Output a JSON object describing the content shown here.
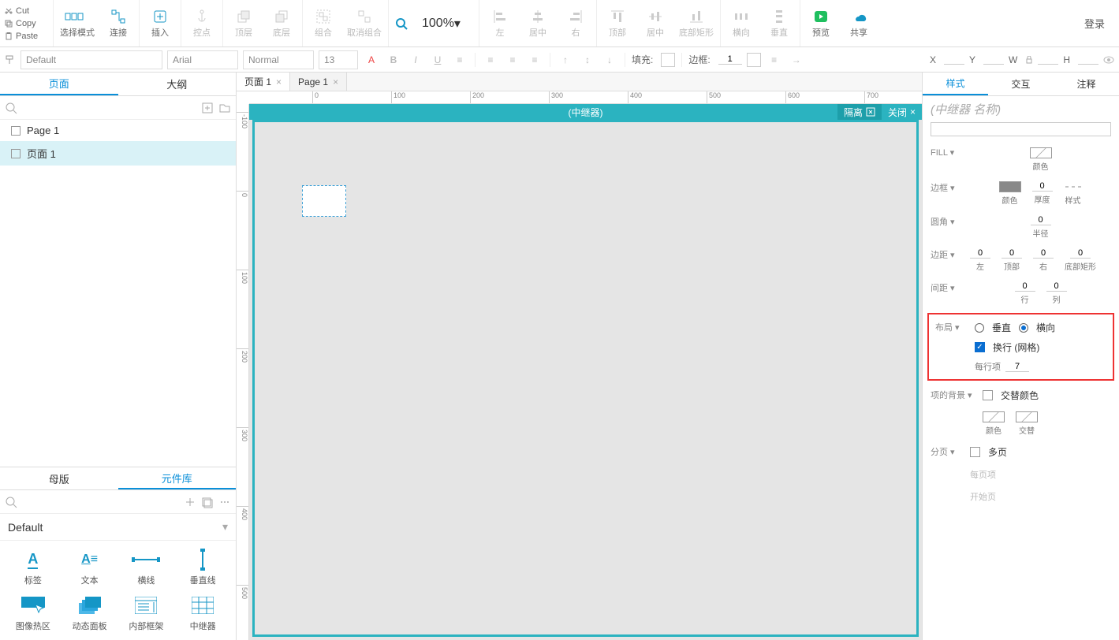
{
  "clipboard": {
    "cut": "Cut",
    "copy": "Copy",
    "paste": "Paste"
  },
  "toolbar": {
    "select_mode": "选择模式",
    "connect": "连接",
    "insert": "插入",
    "anchor": "控点",
    "top_layer": "顶层",
    "bottom_layer": "底层",
    "group": "组合",
    "ungroup": "取消组合",
    "zoom": "100%",
    "align_l": "左",
    "align_c": "居中",
    "align_r": "右",
    "align_t": "顶部",
    "align_m": "居中",
    "align_br": "底部矩形",
    "dist_h": "横向",
    "dist_v": "垂直",
    "preview": "预览",
    "share": "共享",
    "login": "登录"
  },
  "format": {
    "style": "Default",
    "font": "Arial",
    "weight": "Normal",
    "size": "13",
    "fill_label": "填充:",
    "border_label": "边框:",
    "border_w": "1",
    "x": "X",
    "y": "Y",
    "w": "W",
    "h": "H"
  },
  "left_tabs": {
    "pages": "页面",
    "outline": "大纲"
  },
  "pages": {
    "p1": "Page 1",
    "p2": "页面 1"
  },
  "lib_tabs": {
    "master": "母版",
    "widgets": "元件库"
  },
  "lib_head": "Default",
  "widgets": {
    "w1": "标签",
    "w2": "文本",
    "w3": "横线",
    "w4": "垂直线",
    "w5": "图像热区",
    "w6": "动态面板",
    "w7": "内部框架",
    "w8": "中继器"
  },
  "doc_tabs": {
    "t1": "页面 1",
    "t2": "Page 1"
  },
  "repeater": {
    "title": "(中继器)",
    "isolate": "隔离",
    "close": "关闭"
  },
  "ruler_h": [
    "0",
    "100",
    "200",
    "300",
    "400",
    "500",
    "600",
    "700"
  ],
  "ruler_v": [
    "-100",
    "0",
    "100",
    "200",
    "300",
    "400",
    "500"
  ],
  "rtabs": {
    "style": "样式",
    "inter": "交互",
    "notes": "注释"
  },
  "rname": "(中继器 名称)",
  "panel": {
    "fill": "FILL ▾",
    "fill_color": "颜色",
    "border": "边框 ▾",
    "b_color": "颜色",
    "b_thick_v": "0",
    "b_thick": "厚度",
    "b_style": "样式",
    "corner": "圆角 ▾",
    "c_val": "0",
    "c_radius": "半径",
    "margin": "边距 ▾",
    "m_l": "0",
    "m_l_t": "左",
    "m_t": "0",
    "m_t_t": "顶部",
    "m_r": "0",
    "m_r_t": "右",
    "m_b": "0",
    "m_b_t": "底部矩形",
    "gap": "间距 ▾",
    "g_row": "0",
    "g_row_t": "行",
    "g_col": "0",
    "g_col_t": "列",
    "layout": "布局 ▾",
    "lay_v": "垂直",
    "lay_h": "横向",
    "wrap": "换行 (网格)",
    "per_row": "每行项",
    "per_row_v": "7",
    "item_bg": "项的背景 ▾",
    "alt": "交替颜色",
    "bg_color": "颜色",
    "bg_alt": "交替",
    "paging": "分页 ▾",
    "multi": "多页",
    "per_page": "每页项",
    "start": "开始页"
  }
}
